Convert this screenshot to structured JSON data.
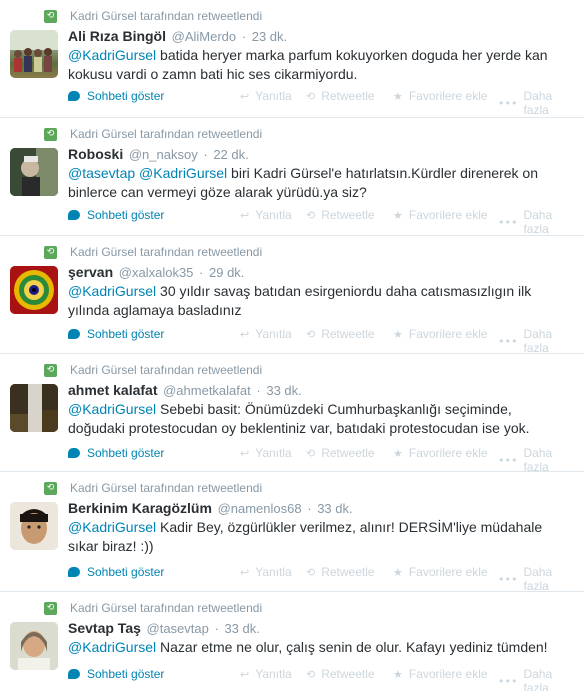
{
  "colors": {
    "link": "#0084b4",
    "retweet_green": "#5ba85b",
    "muted": "#8899a6",
    "action_muted": "#ccd6dd"
  },
  "actions": {
    "show_conversation": "Sohbeti göster",
    "reply": "Yanıtla",
    "retweet": "Retweetle",
    "favorite": "Favorilere ekle",
    "more": "Daha fazla"
  },
  "tweets": [
    {
      "retweeted_by": "Kadri Gürsel tarafından retweetlendi",
      "fullname": "Ali Rıza Bingöl",
      "username": "@AliMerdo",
      "time": "23 dk.",
      "mention": "@KadriGursel",
      "text": " batida heryer marka parfum kokuyorken doguda her yerde kan kokusu vardi o zamn bati hic ses cikarmiyordu."
    },
    {
      "retweeted_by": "Kadri Gürsel tarafından retweetlendi",
      "fullname": "Roboski",
      "username": "@n_naksoy",
      "time": "22 dk.",
      "mention": "@tasevtap",
      "mention2": "@KadriGursel",
      "text": " biri Kadri Gürsel'e hatırlatsın.Kürdler direnerek on binlerce can vermeyi göze alarak yürüdü.ya siz?"
    },
    {
      "retweeted_by": "Kadri Gürsel tarafından retweetlendi",
      "fullname": "şervan",
      "username": "@xalxalok35",
      "time": "29 dk.",
      "mention": "@KadriGursel",
      "text": " 30 yıldır savaş batıdan esirgeniordu daha catısmasızlıgın ilk yılında aglamaya basladınız"
    },
    {
      "retweeted_by": "Kadri Gürsel tarafından retweetlendi",
      "fullname": "ahmet kalafat",
      "username": "@ahmetkalafat",
      "time": "33 dk.",
      "mention": "@KadriGursel",
      "text": " Sebebi basit: Önümüzdeki Cumhurbaşkanlığı seçiminde, doğudaki protestocudan oy beklentiniz var, batıdaki protestocudan ise yok."
    },
    {
      "retweeted_by": "Kadri Gürsel tarafından retweetlendi",
      "fullname": "Berkinim Karagözlüm",
      "username": "@namenlos68",
      "time": "33 dk.",
      "mention": "@KadriGursel",
      "text": " Kadir Bey, özgürlükler verilmez, alınır! DERSİM'liye müdahale sıkar biraz! :))"
    },
    {
      "retweeted_by": "Kadri Gürsel tarafından retweetlendi",
      "fullname": "Sevtap Taş",
      "username": "@tasevtap",
      "time": "33 dk.",
      "mention": "@KadriGursel",
      "text": " Nazar etme ne olur, çalış senin de olur. Kafayı yediniz tümden!"
    }
  ]
}
